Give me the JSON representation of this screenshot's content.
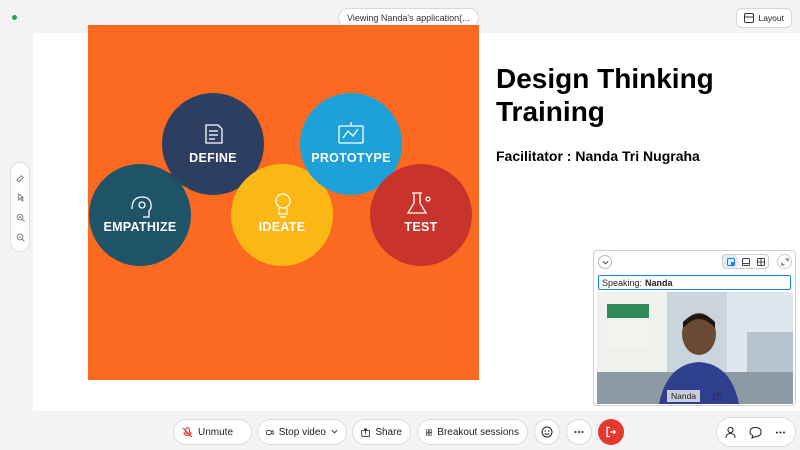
{
  "viewing_banner": "Viewing Nanda's application(...",
  "layout_button": {
    "label": "Layout",
    "icon": "layout-icon"
  },
  "zoom_tools": [
    "annotate-icon",
    "pointer-icon",
    "zoom-in-icon",
    "zoom-out-icon"
  ],
  "slide": {
    "title": "Design Thinking Training",
    "facilitator": "Facilitator : Nanda Tri Nugraha",
    "background": "#fb6a20",
    "stages": [
      {
        "label": "EMPATHIZE",
        "color": "#1f5468",
        "icon": "head-gear-icon"
      },
      {
        "label": "DEFINE",
        "color": "#2d3f60",
        "icon": "document-icon"
      },
      {
        "label": "IDEATE",
        "color": "#fbb713",
        "icon": "lightbulb-icon"
      },
      {
        "label": "PROTOTYPE",
        "color": "#1ea0d8",
        "icon": "blueprint-icon"
      },
      {
        "label": "TEST",
        "color": "#c8332b",
        "icon": "flask-icon"
      }
    ]
  },
  "video_panel": {
    "speaking_label": "Speaking:",
    "speaker_name": "Nanda",
    "participant_name": "Nanda",
    "view_modes": [
      "speaker-view-icon",
      "stage-view-icon",
      "grid-view-icon"
    ],
    "active_view": 0
  },
  "toolbar": {
    "unmute": "Unmute",
    "stop_video": "Stop video",
    "share": "Share",
    "breakout": "Breakout sessions"
  },
  "colors": {
    "accent": "#1a7df0",
    "end_call": "#e5382e",
    "mic_muted": "#e5382e"
  }
}
